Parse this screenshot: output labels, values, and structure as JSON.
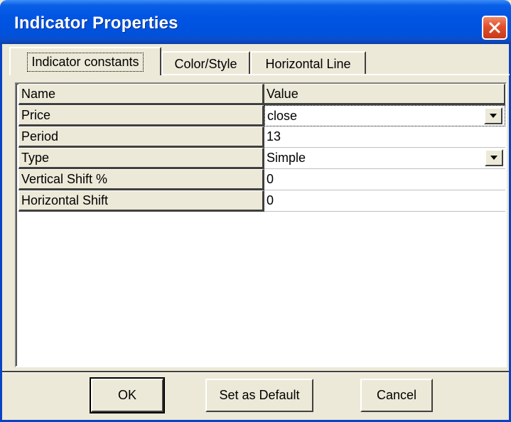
{
  "window": {
    "title": "Indicator Properties"
  },
  "tabs": [
    {
      "label": "Indicator constants",
      "active": true
    },
    {
      "label": "Color/Style",
      "active": false
    },
    {
      "label": "Horizontal Line",
      "active": false
    }
  ],
  "grid": {
    "columns": [
      "Name",
      "Value"
    ],
    "rows": [
      {
        "name": "Price",
        "value": "close",
        "dropdown": true
      },
      {
        "name": "Period",
        "value": "13",
        "dropdown": false
      },
      {
        "name": "Type",
        "value": "Simple",
        "dropdown": true
      },
      {
        "name": "Vertical Shift %",
        "value": "0",
        "dropdown": false
      },
      {
        "name": "Horizontal Shift",
        "value": "0",
        "dropdown": false
      }
    ]
  },
  "buttons": {
    "ok": "OK",
    "set_default": "Set as Default",
    "cancel": "Cancel"
  },
  "icons": {
    "close": "close-icon",
    "dropdown": "chevron-down-icon"
  },
  "colors": {
    "titlebar": "#0054e3",
    "face": "#ece9d8",
    "close_button": "#e0502c"
  }
}
